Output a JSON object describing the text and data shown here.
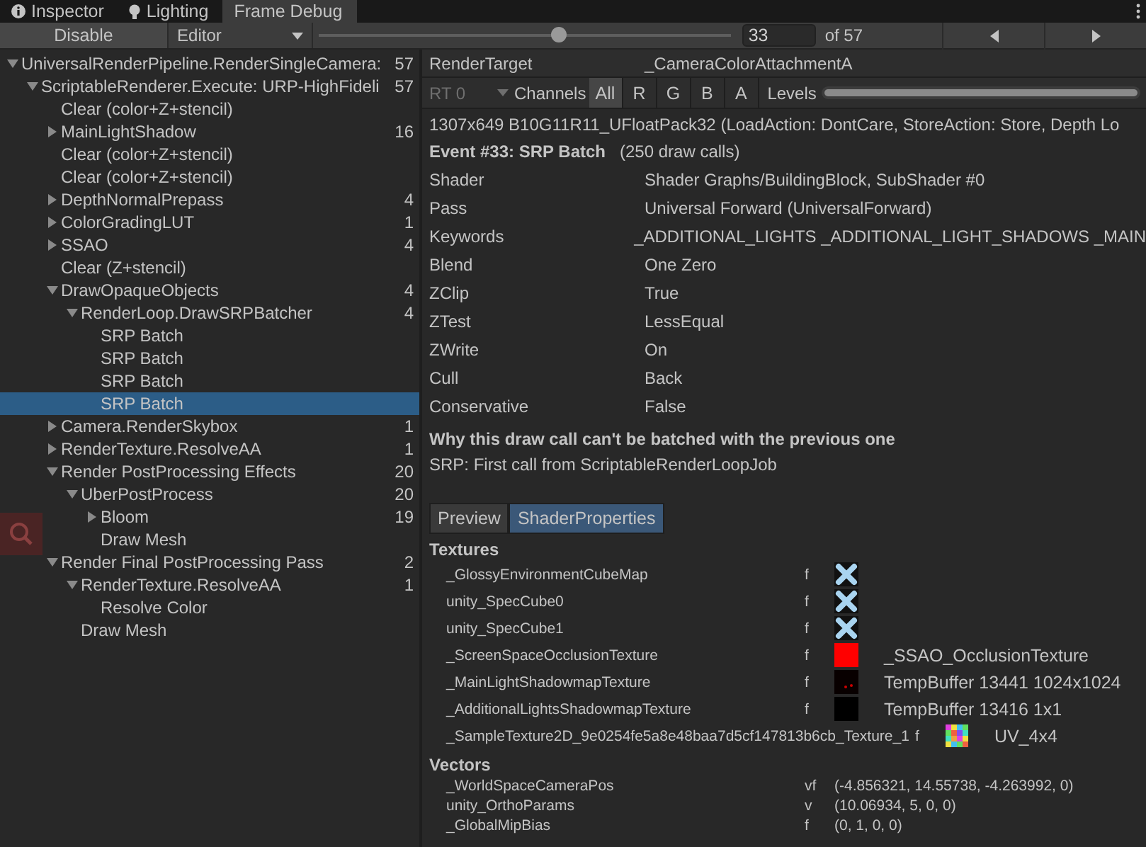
{
  "tabs": [
    {
      "label": "Inspector",
      "selected": false
    },
    {
      "label": "Lighting",
      "selected": false
    },
    {
      "label": "Frame Debug",
      "selected": true
    }
  ],
  "toolbar": {
    "disable_button": "Disable",
    "target_dropdown": "Editor",
    "event_slider": {
      "level": 0.58
    },
    "event_field": "33",
    "event_total": "of 57"
  },
  "tree": [
    {
      "label": "UniversalRenderPipeline.RenderSingleCamera:",
      "count": "57",
      "kind": "node",
      "expanded": true,
      "selected": false,
      "children": [
        {
          "label": "ScriptableRenderer.Execute: URP-HighFideli",
          "count": "57",
          "kind": "node",
          "expanded": true,
          "selected": false,
          "children": [
            {
              "label": "Clear (color+Z+stencil)",
              "kind": "leaf",
              "selected": false
            },
            {
              "label": "MainLightShadow",
              "count": "16",
              "kind": "node",
              "expanded": false,
              "selected": false
            },
            {
              "label": "Clear (color+Z+stencil)",
              "kind": "leaf",
              "selected": false
            },
            {
              "label": "Clear (color+Z+stencil)",
              "kind": "leaf",
              "selected": false
            },
            {
              "label": "DepthNormalPrepass",
              "count": "4",
              "kind": "node",
              "expanded": false,
              "selected": false
            },
            {
              "label": "ColorGradingLUT",
              "count": "1",
              "kind": "node",
              "expanded": false,
              "selected": false
            },
            {
              "label": "SSAO",
              "count": "4",
              "kind": "node",
              "expanded": false,
              "selected": false
            },
            {
              "label": "Clear (Z+stencil)",
              "kind": "leaf",
              "selected": false
            },
            {
              "label": "DrawOpaqueObjects",
              "count": "4",
              "kind": "node",
              "expanded": true,
              "selected": false,
              "children": [
                {
                  "label": "RenderLoop.DrawSRPBatcher",
                  "count": "4",
                  "kind": "node",
                  "expanded": true,
                  "selected": false,
                  "children": [
                    {
                      "label": "SRP Batch",
                      "kind": "leaf",
                      "selected": false
                    },
                    {
                      "label": "SRP Batch",
                      "kind": "leaf",
                      "selected": false
                    },
                    {
                      "label": "SRP Batch",
                      "kind": "leaf",
                      "selected": false
                    },
                    {
                      "label": "SRP Batch",
                      "kind": "leaf",
                      "selected": true
                    }
                  ]
                }
              ]
            },
            {
              "label": "Camera.RenderSkybox",
              "count": "1",
              "kind": "node",
              "expanded": false,
              "selected": false
            },
            {
              "label": "RenderTexture.ResolveAA",
              "count": "1",
              "kind": "node",
              "expanded": false,
              "selected": false
            },
            {
              "label": "Render PostProcessing Effects",
              "count": "20",
              "kind": "node",
              "expanded": true,
              "selected": false,
              "children": [
                {
                  "label": "UberPostProcess",
                  "count": "20",
                  "kind": "node",
                  "expanded": true,
                  "selected": false,
                  "children": [
                    {
                      "label": "Bloom",
                      "count": "19",
                      "kind": "node",
                      "expanded": false,
                      "selected": false
                    },
                    {
                      "label": "Draw Mesh",
                      "kind": "leaf",
                      "selected": false
                    }
                  ]
                }
              ]
            },
            {
              "label": "Render Final PostProcessing Pass",
              "count": "2",
              "kind": "node",
              "expanded": true,
              "selected": false,
              "children": [
                {
                  "label": "RenderTexture.ResolveAA",
                  "count": "1",
                  "kind": "node",
                  "expanded": true,
                  "selected": false,
                  "children": [
                    {
                      "label": "Resolve Color",
                      "kind": "leaf",
                      "selected": false
                    }
                  ]
                },
                {
                  "label": "Draw Mesh",
                  "kind": "leaf",
                  "selected": false
                }
              ]
            }
          ]
        }
      ]
    }
  ],
  "render_target": {
    "label": "RenderTarget",
    "value": "_CameraColorAttachmentA"
  },
  "channels": {
    "rt_dropdown": "RT 0",
    "label": "Channels",
    "buttons": [
      {
        "label": "All",
        "selected": true
      },
      {
        "label": "R",
        "selected": false
      },
      {
        "label": "G",
        "selected": false
      },
      {
        "label": "B",
        "selected": false
      },
      {
        "label": "A",
        "selected": false
      }
    ],
    "levels_label": "Levels",
    "levels_slider": {
      "level": 1
    }
  },
  "format_info": "1307x649 B10G11R11_UFloatPack32 (LoadAction: DontCare, StoreAction: Store, Depth Lo",
  "event": {
    "title": "Event #33: SRP Batch",
    "draw_calls": "(250 draw calls)"
  },
  "properties": [
    {
      "name": "Shader",
      "value": "Shader Graphs/BuildingBlock, SubShader #0"
    },
    {
      "name": "Pass",
      "value": "Universal Forward (UniversalForward)"
    },
    {
      "name": "Keywords",
      "value": "_ADDITIONAL_LIGHTS _ADDITIONAL_LIGHT_SHADOWS _MAIN"
    },
    {
      "name": "Blend",
      "value": "One Zero"
    },
    {
      "name": "ZClip",
      "value": "True"
    },
    {
      "name": "ZTest",
      "value": "LessEqual"
    },
    {
      "name": "ZWrite",
      "value": "On"
    },
    {
      "name": "Cull",
      "value": "Back"
    },
    {
      "name": "Conservative",
      "value": "False"
    }
  ],
  "batch_reason": {
    "title": "Why this draw call can't be batched with the previous one",
    "detail": "SRP: First call from ScriptableRenderLoopJob"
  },
  "detail_tabs": [
    {
      "label": "Preview",
      "selected": false
    },
    {
      "label": "ShaderProperties",
      "selected": true
    }
  ],
  "textures": {
    "title": "Textures",
    "rows": [
      {
        "name": "_GlossyEnvironmentCubeMap",
        "type": "f",
        "kind": "missing"
      },
      {
        "name": "unity_SpecCube0",
        "type": "f",
        "kind": "missing"
      },
      {
        "name": "unity_SpecCube1",
        "type": "f",
        "kind": "missing"
      },
      {
        "name": "_ScreenSpaceOcclusionTexture",
        "type": "f",
        "kind": "red",
        "value": "_SSAO_OcclusionTexture"
      },
      {
        "name": "_MainLightShadowmapTexture",
        "type": "f",
        "kind": "shadow",
        "value": "TempBuffer 13441 1024x1024"
      },
      {
        "name": "_AdditionalLightsShadowmapTexture",
        "type": "f",
        "kind": "black",
        "value": "TempBuffer 13416 1x1"
      },
      {
        "name": "_SampleTexture2D_9e0254fe5a8e48baa7d5cf147813b6cb_Texture_1",
        "type": "f",
        "kind": "grid",
        "value": "UV_4x4"
      }
    ]
  },
  "vectors": {
    "title": "Vectors",
    "rows": [
      {
        "name": "_WorldSpaceCameraPos",
        "type": "vf",
        "value": "(-4.856321, 14.55738, -4.263992, 0)"
      },
      {
        "name": "unity_OrthoParams",
        "type": "v",
        "value": "(10.06934, 5, 0, 0)"
      },
      {
        "name": "_GlobalMipBias",
        "type": "f",
        "value": "(0, 1, 0, 0)"
      }
    ]
  }
}
